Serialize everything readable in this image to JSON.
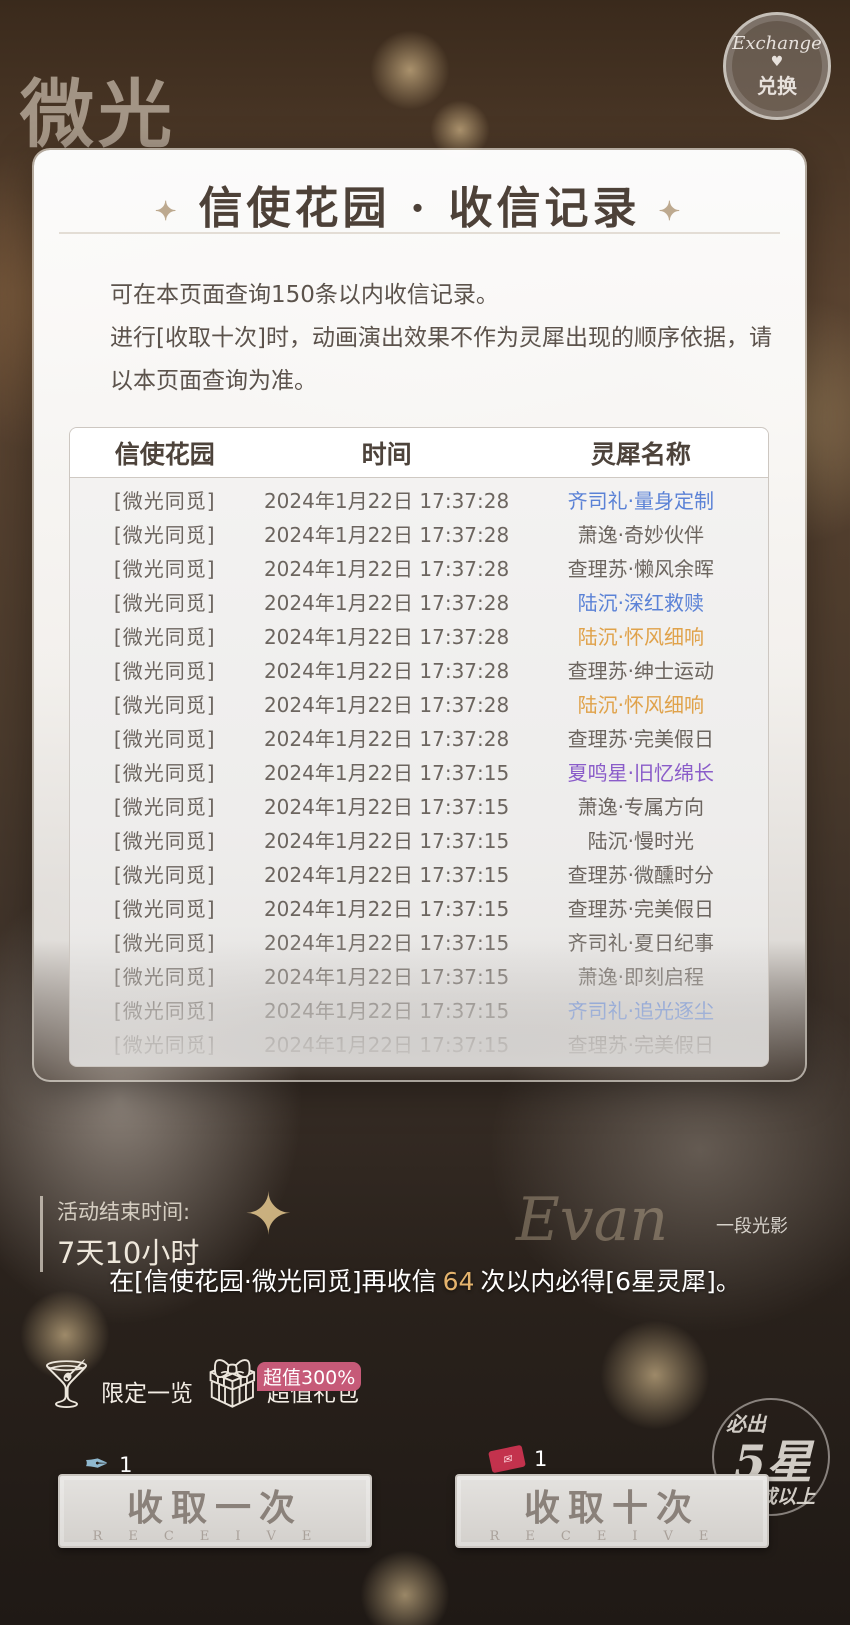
{
  "background": {
    "title_text": "微光"
  },
  "exchange_badge": {
    "en": "Exchange",
    "cn": "兑换"
  },
  "panel": {
    "title": "信使花园 · 收信记录",
    "description": [
      "可在本页面查询150条以内收信记录。",
      "进行[收取十次]时，动画演出效果不作为灵犀出现的顺序依据，请以本页面查询为准。"
    ]
  },
  "table": {
    "headers": [
      "信使花园",
      "时间",
      "灵犀名称"
    ],
    "rows": [
      {
        "pool": "[微光同觅]",
        "time": "2024年1月22日 17:37:28",
        "name": "齐司礼·量身定制",
        "color": "#5b82d6"
      },
      {
        "pool": "[微光同觅]",
        "time": "2024年1月22日 17:37:28",
        "name": "萧逸·奇妙伙伴",
        "color": "#6c655f"
      },
      {
        "pool": "[微光同觅]",
        "time": "2024年1月22日 17:37:28",
        "name": "查理苏·懒风余晖",
        "color": "#6c655f"
      },
      {
        "pool": "[微光同觅]",
        "time": "2024年1月22日 17:37:28",
        "name": "陆沉·深红救赎",
        "color": "#5b82d6"
      },
      {
        "pool": "[微光同觅]",
        "time": "2024年1月22日 17:37:28",
        "name": "陆沉·怀风细响",
        "color": "#e0a24a"
      },
      {
        "pool": "[微光同觅]",
        "time": "2024年1月22日 17:37:28",
        "name": "查理苏·绅士运动",
        "color": "#6c655f"
      },
      {
        "pool": "[微光同觅]",
        "time": "2024年1月22日 17:37:28",
        "name": "陆沉·怀风细响",
        "color": "#e0a24a"
      },
      {
        "pool": "[微光同觅]",
        "time": "2024年1月22日 17:37:28",
        "name": "查理苏·完美假日",
        "color": "#6c655f"
      },
      {
        "pool": "[微光同觅]",
        "time": "2024年1月22日 17:37:15",
        "name": "夏鸣星·旧忆绵长",
        "color": "#8a5cc9"
      },
      {
        "pool": "[微光同觅]",
        "time": "2024年1月22日 17:37:15",
        "name": "萧逸·专属方向",
        "color": "#6c655f"
      },
      {
        "pool": "[微光同觅]",
        "time": "2024年1月22日 17:37:15",
        "name": "陆沉·慢时光",
        "color": "#6c655f"
      },
      {
        "pool": "[微光同觅]",
        "time": "2024年1月22日 17:37:15",
        "name": "查理苏·微醺时分",
        "color": "#6c655f"
      },
      {
        "pool": "[微光同觅]",
        "time": "2024年1月22日 17:37:15",
        "name": "查理苏·完美假日",
        "color": "#6c655f"
      },
      {
        "pool": "[微光同觅]",
        "time": "2024年1月22日 17:37:15",
        "name": "齐司礼·夏日纪事",
        "color": "#6c655f"
      },
      {
        "pool": "[微光同觅]",
        "time": "2024年1月22日 17:37:15",
        "name": "萧逸·即刻启程",
        "color": "#6c655f"
      },
      {
        "pool": "[微光同觅]",
        "time": "2024年1月22日 17:37:15",
        "name": "齐司礼·追光逐尘",
        "color": "#5b82d6"
      },
      {
        "pool": "[微光同觅]",
        "time": "2024年1月22日 17:37:15",
        "name": "查理苏·完美假日",
        "color": "#6c655f"
      }
    ]
  },
  "event": {
    "end_label": "活动结束时间:",
    "end_value": "7天10小时",
    "watermark": "Evan",
    "caption": "一段光影"
  },
  "guarantee": {
    "prefix": "在[信使花园·微光同觅]再收信",
    "count": "64",
    "suffix": "次以内必得[6星灵犀]。"
  },
  "shop": {
    "limited_label": "限定一览",
    "gift_label": "超值礼包",
    "gift_badge": "超值300%"
  },
  "guarantee_badge": {
    "line1": "必出",
    "line2": "5星",
    "line3": "或以上"
  },
  "buttons": {
    "single": {
      "label": "收取一次",
      "sub": "RECEIVE",
      "cost": "1"
    },
    "ten": {
      "label": "收取十次",
      "sub": "RECEIVE",
      "cost": "1"
    }
  },
  "colors": {
    "highlight": "#e4b36d",
    "blue": "#5b82d6",
    "gold": "#e0a24a",
    "purple": "#8a5cc9"
  }
}
